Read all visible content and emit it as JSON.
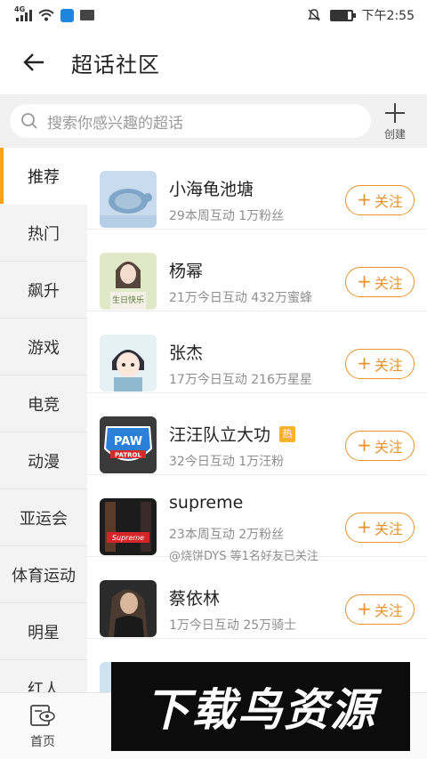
{
  "status_bar": {
    "network": "4G",
    "time": "下午2:55",
    "battery_level": 0.85
  },
  "header": {
    "title": "超话社区",
    "back_icon": "arrow-left-icon"
  },
  "search": {
    "placeholder": "搜索你感兴趣的超话",
    "create_label": "创建"
  },
  "sidebar": {
    "items": [
      {
        "label": "推荐",
        "active": true
      },
      {
        "label": "热门",
        "active": false
      },
      {
        "label": "飙升",
        "active": false
      },
      {
        "label": "游戏",
        "active": false
      },
      {
        "label": "电竞",
        "active": false
      },
      {
        "label": "动漫",
        "active": false
      },
      {
        "label": "亚运会",
        "active": false
      },
      {
        "label": "体育运动",
        "active": false
      },
      {
        "label": "明星",
        "active": false
      },
      {
        "label": "红人",
        "active": false
      }
    ]
  },
  "topics": [
    {
      "name": "小海龟池塘",
      "meta": "29本周互动 1万粉丝",
      "hot": false,
      "extra": "",
      "follow": "关注"
    },
    {
      "name": "杨幂",
      "meta": "21万今日互动 432万蜜蜂",
      "hot": false,
      "extra": "",
      "follow": "关注",
      "thumb_text": "生日快乐"
    },
    {
      "name": "张杰",
      "meta": "17万今日互动 216万星星",
      "hot": false,
      "extra": "",
      "follow": "关注"
    },
    {
      "name": "汪汪队立大功",
      "meta": "32今日互动 1万汪粉",
      "hot": true,
      "hot_label": "热",
      "extra": "",
      "follow": "关注",
      "thumb_text": "PAW PATROL"
    },
    {
      "name": "supreme",
      "meta": "23本周互动 2万粉丝",
      "hot": false,
      "extra": "@烧饼DYS 等1名好友已关注",
      "follow": "关注",
      "thumb_text": "Supreme"
    },
    {
      "name": "蔡依林",
      "meta": "1万今日互动 25万骑士",
      "hot": false,
      "extra": "",
      "follow": "关注"
    }
  ],
  "bottom_nav": {
    "home_label": "首页"
  },
  "watermark": "下载鸟资源",
  "colors": {
    "accent": "#e8922a",
    "active_bar": "#f7a21b",
    "hot_badge": "#f7b228"
  }
}
